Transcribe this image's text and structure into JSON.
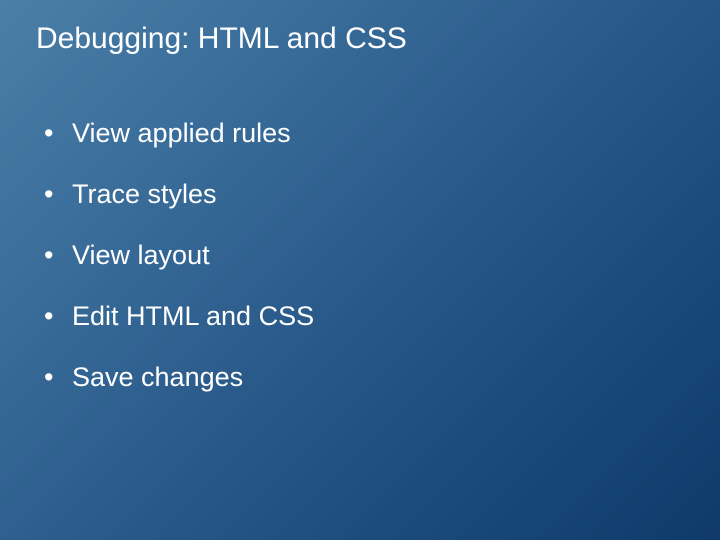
{
  "slide": {
    "title": "Debugging: HTML and CSS",
    "bullets": [
      "View applied rules",
      "Trace styles",
      "View layout",
      "Edit HTML and CSS",
      "Save changes"
    ]
  }
}
